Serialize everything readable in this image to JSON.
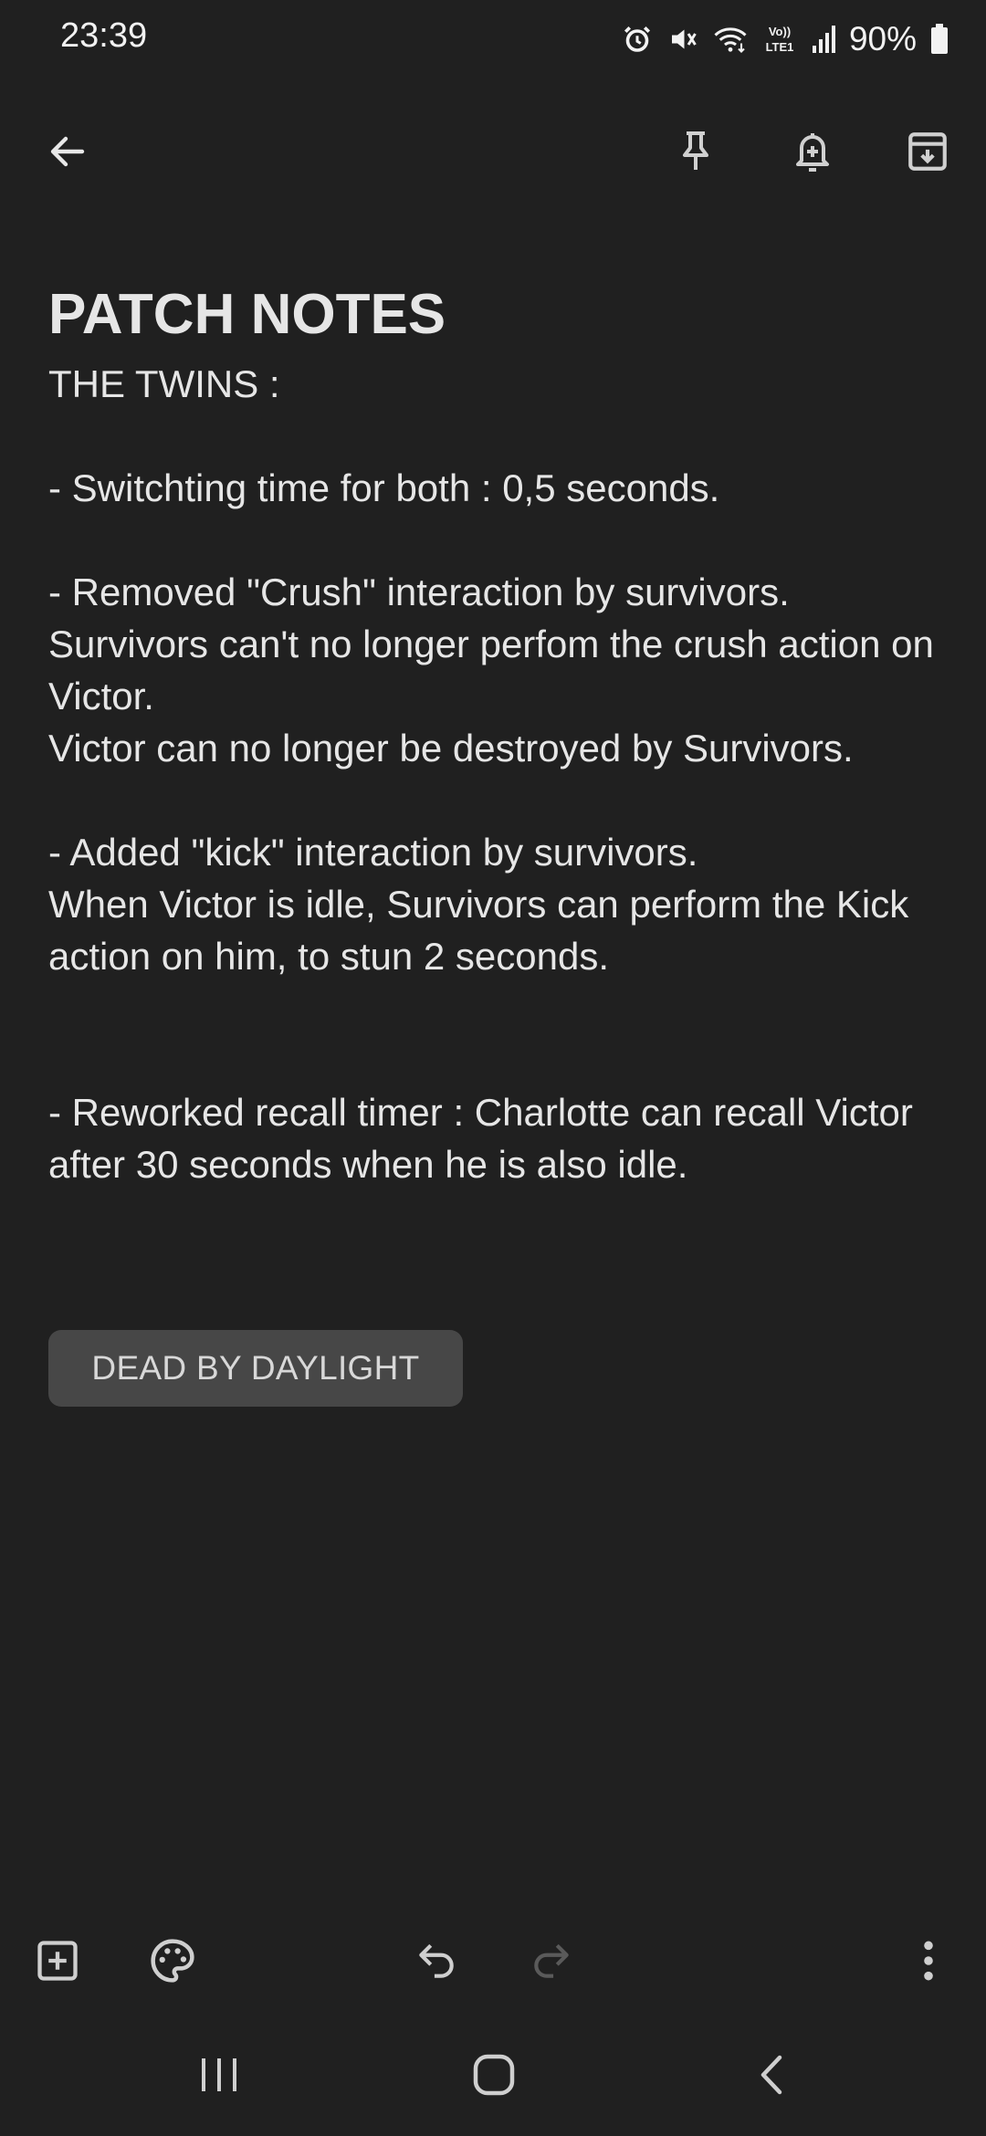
{
  "status_bar": {
    "time": "23:39",
    "battery": "90%",
    "icons": [
      "alarm-icon",
      "mute-icon",
      "wifi-icon",
      "volte-icon",
      "signal-icon",
      "battery-icon"
    ],
    "volte_label": "Vo)) LTE1"
  },
  "toolbar": {
    "icons": [
      "back-arrow-icon",
      "pin-icon",
      "reminder-bell-icon",
      "archive-icon"
    ]
  },
  "note": {
    "title": "PATCH NOTES",
    "body": "THE TWINS :\n\n- Switchting time for both : 0,5 seconds.\n\n- Removed \"Crush\" interaction by survivors.\nSurvivors can't no longer perfom the crush action on Victor.\nVictor can no longer be destroyed by Survivors.\n\n- Added \"kick\" interaction by survivors.\nWhen Victor is idle, Survivors can perform the Kick action on him, to stun 2 seconds.\n\n\n- Reworked recall timer : Charlotte can recall Victor after 30 seconds when he is also idle."
  },
  "label": {
    "text": "DEAD BY DAYLIGHT"
  },
  "bottom_bar": {
    "icons": [
      "add-box-icon",
      "palette-icon",
      "undo-icon",
      "redo-icon",
      "more-vert-icon"
    ]
  },
  "nav_bar": {
    "icons": [
      "recents-icon",
      "home-icon",
      "back-icon"
    ]
  },
  "colors": {
    "background": "#202020",
    "text": "#e6e6e6",
    "chip_background": "#474747",
    "disabled_icon": "#5a5a5a"
  }
}
